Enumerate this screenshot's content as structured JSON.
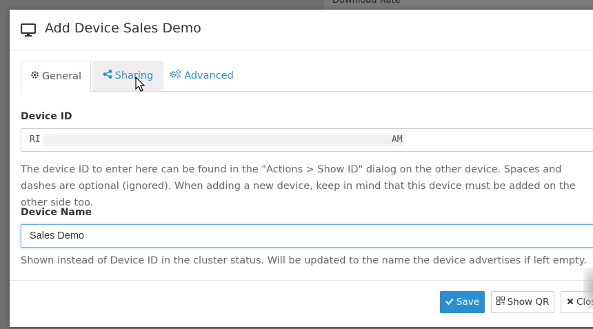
{
  "background": {
    "text": "Download Rate"
  },
  "modal": {
    "title": "Add Device Sales Demo",
    "icon": "monitor-icon"
  },
  "tabs": [
    {
      "label": "General",
      "icon": "gear-icon",
      "active": true
    },
    {
      "label": "Sharing",
      "icon": "share-icon",
      "active": false
    },
    {
      "label": "Advanced",
      "icon": "cogs-icon",
      "active": false
    }
  ],
  "device_id": {
    "label": "Device ID",
    "value_start": "RI",
    "value_end": "AM",
    "help": "The device ID to enter here can be found in the \"Actions > Show ID\" dialog on the other device. Spaces and dashes are optional (ignored). When adding a new device, keep in mind that this device must be added on the other side too."
  },
  "device_name": {
    "label": "Device Name",
    "value": "Sales Demo",
    "help": "Shown instead of Device ID in the cluster status. Will be updated to the name the device advertises if left empty."
  },
  "footer": {
    "save_label": "Save",
    "show_qr_label": "Show QR",
    "close_label": "Close"
  },
  "colors": {
    "primary": "#2a8fd0",
    "link": "#2a8fd0"
  }
}
